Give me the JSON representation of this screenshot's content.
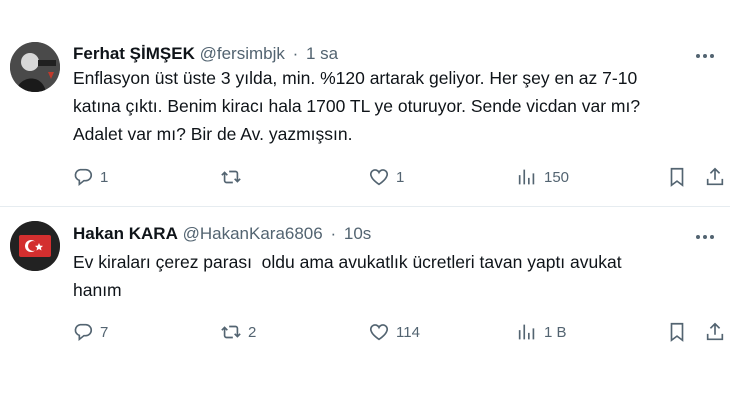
{
  "tweets": [
    {
      "name": "Ferhat ŞİMŞEK",
      "handle": "@fersimbjk",
      "separator": "·",
      "time": "1 sa",
      "text": "Enflasyon üst üste 3 yılda, min. %120 artarak geliyor. Her şey en az 7-10\nkatına çıktı. Benim kiracı hala 1700 TL ye oturuyor. Sende vicdan var mı?\nAdalet var mı? Bir de Av. yazmışsın.",
      "replies": "1",
      "retweets": "",
      "likes": "1",
      "views": "150"
    },
    {
      "name": "Hakan KARA",
      "handle": "@HakanKara6806",
      "separator": "·",
      "time": "10s",
      "text": "Ev kiraları çerez parası  oldu ama avukatlık ücretleri tavan yaptı avukat\nhanım",
      "replies": "7",
      "retweets": "2",
      "likes": "114",
      "views": "1 B"
    }
  ],
  "colors": {
    "text": "#0f1419",
    "secondary": "#536471",
    "divider": "#e6ecf0"
  },
  "icons": [
    "more-icon",
    "reply-icon",
    "retweet-icon",
    "like-icon",
    "views-icon",
    "bookmark-icon",
    "share-icon"
  ]
}
